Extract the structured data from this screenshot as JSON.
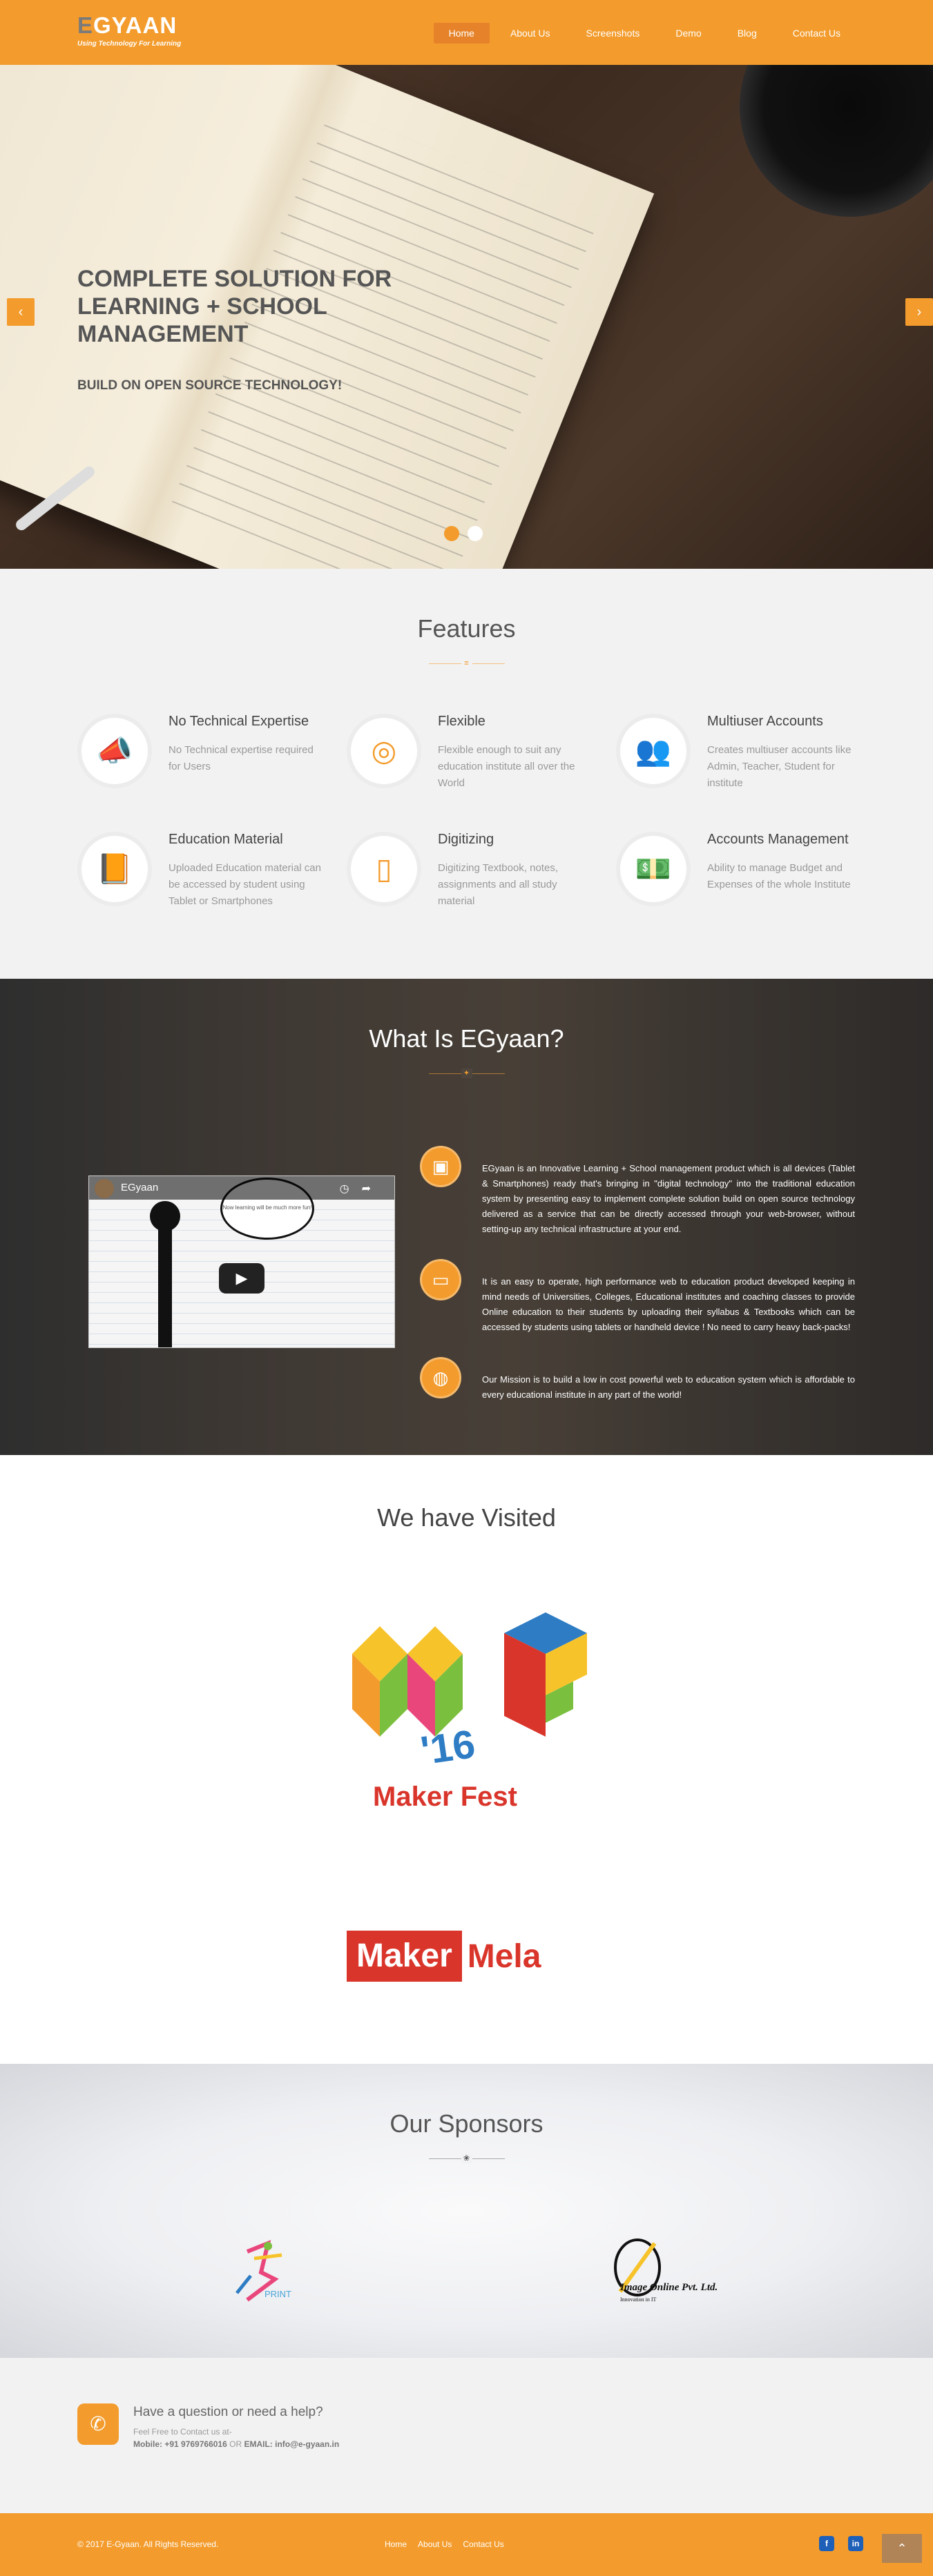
{
  "header": {
    "logo_title": "GYAAN",
    "logo_e": "E",
    "logo_tagline": "Using Technology For Learning",
    "nav": [
      "Home",
      "About Us",
      "Screenshots",
      "Demo",
      "Blog",
      "Contact Us"
    ]
  },
  "hero": {
    "title": "COMPLETE SOLUTION FOR LEARNING + SCHOOL MANAGEMENT",
    "subtitle": "BUILD ON OPEN SOURCE TECHNOLOGY!",
    "prev_icon": "chevron-left-icon",
    "next_icon": "chevron-right-icon",
    "active_slide": 1,
    "slide_count": 2
  },
  "features": {
    "title": "Features",
    "items": [
      {
        "title": "No Technical Expertise",
        "desc": "No Technical expertise required for Users",
        "icon": "megaphone-icon"
      },
      {
        "title": "Flexible",
        "desc": "Flexible enough to suit any education institute all over the World",
        "icon": "target-icon"
      },
      {
        "title": "Multiuser Accounts",
        "desc": "Creates multiuser accounts like Admin, Teacher, Student for institute",
        "icon": "users-icon"
      },
      {
        "title": "Education Material",
        "desc": "Uploaded Education material can be accessed by student using Tablet or Smartphones",
        "icon": "book-icon"
      },
      {
        "title": "Digitizing",
        "desc": "Digitizing Textbook, notes, assignments and all study material",
        "icon": "mobile-icon"
      },
      {
        "title": "Accounts Management",
        "desc": "Ability to manage Budget and Expenses of the whole Institute",
        "icon": "money-icon"
      }
    ]
  },
  "what": {
    "title": "What Is EGyaan?",
    "video": {
      "title": "EGyaan",
      "bubble": "Now learning will be much more fun!"
    },
    "items": [
      {
        "icon": "tablet-icon",
        "text": "EGyaan is an Innovative Learning + School management product which is all devices (Tablet & Smartphones) ready that's bringing in \"digital technology\" into the traditional education system by presenting easy to implement complete solution build on open source technology delivered as a service that can be directly accessed through your web-browser, without setting-up any technical infrastructure at your end."
      },
      {
        "icon": "devices-icon",
        "text": "It is an easy to operate, high performance web to education product developed keeping in mind needs of Universities, Colleges, Educational institutes and coaching classes to provide Online education to their students by uploading their syllabus & Textbooks which can be accessed by students using tablets or handheld device ! No need to carry heavy back-packs!"
      },
      {
        "icon": "globe-icon",
        "text": "Our Mission is to build a low in cost powerful web to education system which is affordable to every educational institute in any part of the world!"
      }
    ]
  },
  "visited": {
    "title": "We have Visited",
    "makerfest_year": "'16",
    "makerfest_label": "Maker Fest",
    "makermela_a": "Maker",
    "makermela_b": "Mela"
  },
  "sponsors": {
    "title": "Our Sponsors",
    "sponsor1": "PRINT",
    "sponsor2": "Image Online Pvt. Ltd.",
    "sponsor2_tag": "Innovation in IT"
  },
  "help": {
    "title": "Have a question or need a help?",
    "line": "Feel Free to Contact us at-",
    "mobile_label": "Mobile:",
    "mobile": "+91 9769766016",
    "or": "OR",
    "email_label": "EMAIL:",
    "email": "info@e-gyaan.in"
  },
  "footer": {
    "copyright": "© 2017 E-Gyaan. All Rights Reserved.",
    "links": [
      "Home",
      "About Us",
      "Contact Us"
    ],
    "social": [
      "f",
      "in"
    ]
  },
  "colors": {
    "accent": "#f39c2d",
    "text": "#666666"
  }
}
